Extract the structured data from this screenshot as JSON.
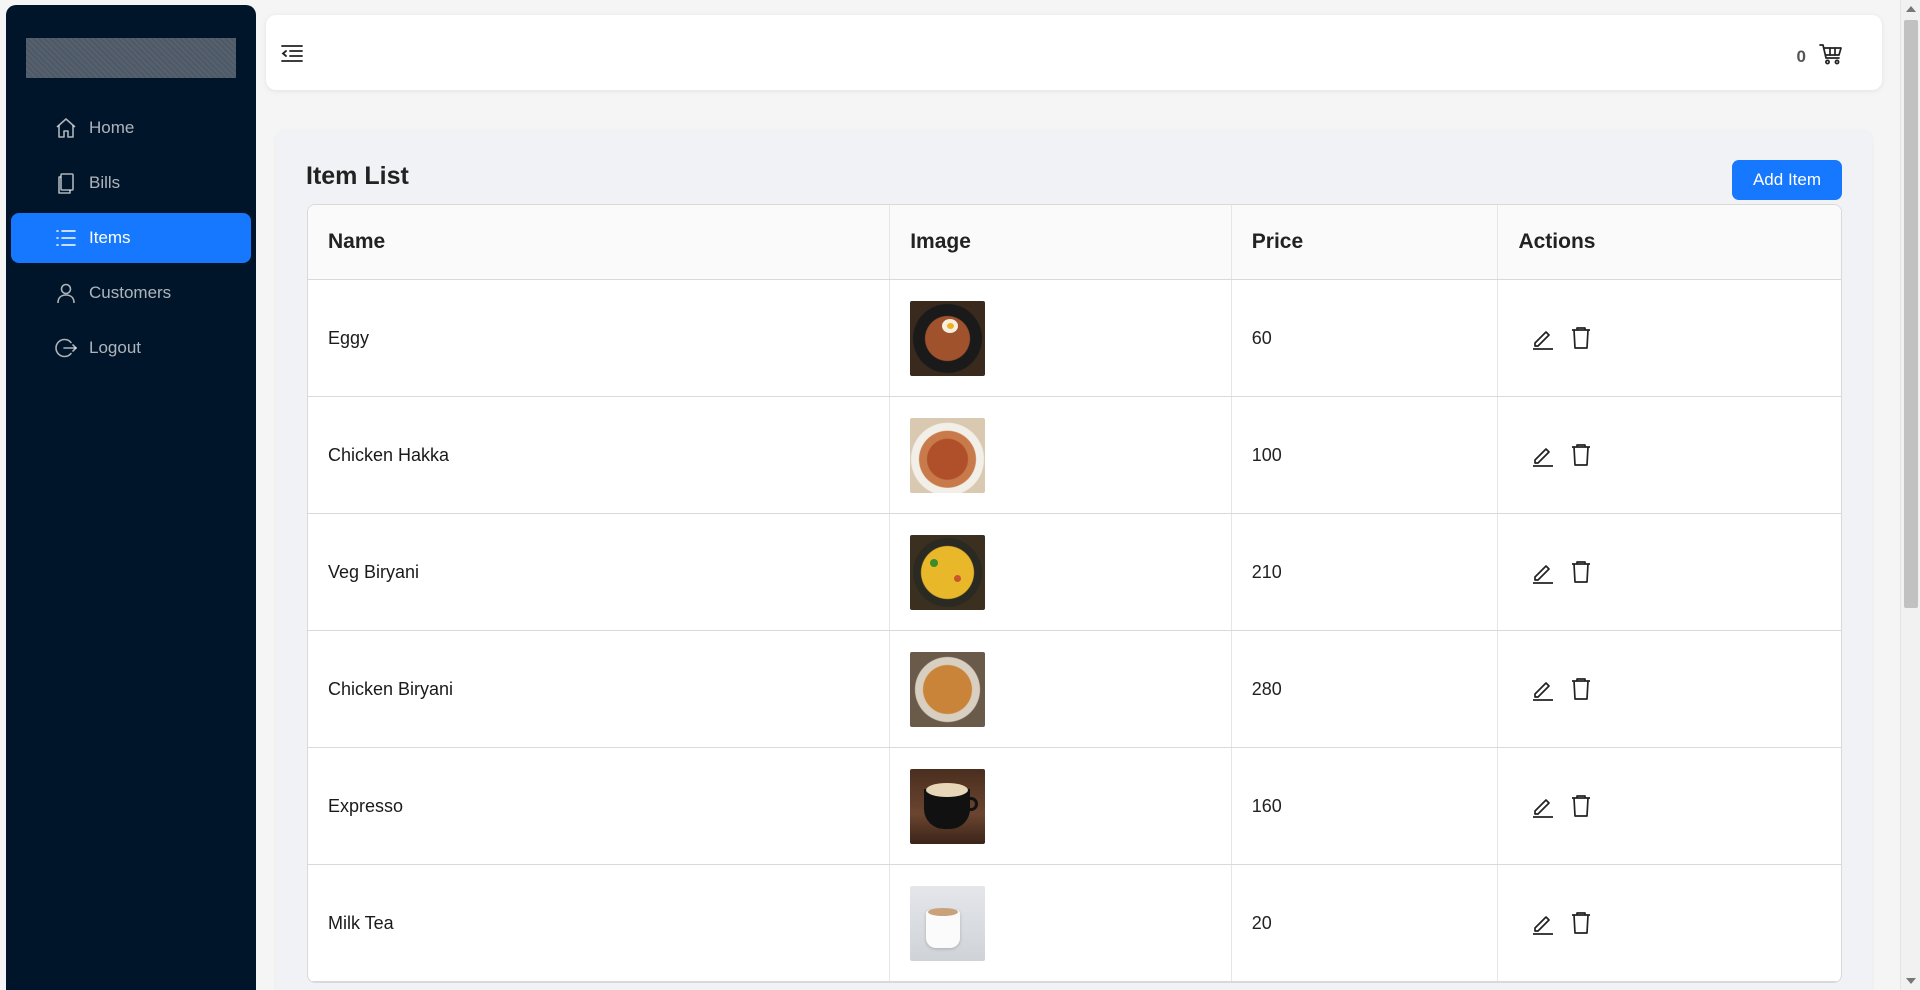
{
  "sidebar": {
    "items": [
      {
        "label": "Home",
        "icon": "home-icon",
        "active": false
      },
      {
        "label": "Bills",
        "icon": "copy-icon",
        "active": false
      },
      {
        "label": "Items",
        "icon": "list-icon",
        "active": true
      },
      {
        "label": "Customers",
        "icon": "user-icon",
        "active": false
      },
      {
        "label": "Logout",
        "icon": "logout-icon",
        "active": false
      }
    ]
  },
  "header": {
    "cart_count": "0"
  },
  "main": {
    "title": "Item List",
    "add_button": "Add Item",
    "columns": [
      "Name",
      "Image",
      "Price",
      "Actions"
    ],
    "rows": [
      {
        "name": "Eggy",
        "price": "60",
        "image": "noodles-with-egg"
      },
      {
        "name": "Chicken Hakka",
        "price": "100",
        "image": "hakka-noodles"
      },
      {
        "name": "Veg Biryani",
        "price": "210",
        "image": "veg-biryani"
      },
      {
        "name": "Chicken Biryani",
        "price": "280",
        "image": "chicken-biryani"
      },
      {
        "name": "Expresso",
        "price": "160",
        "image": "coffee-cup"
      },
      {
        "name": "Milk Tea",
        "price": "20",
        "image": "tea-cup"
      }
    ]
  },
  "colors": {
    "sidebar_bg": "#001529",
    "accent": "#1677ff",
    "page_bg": "#f5f5f5"
  }
}
